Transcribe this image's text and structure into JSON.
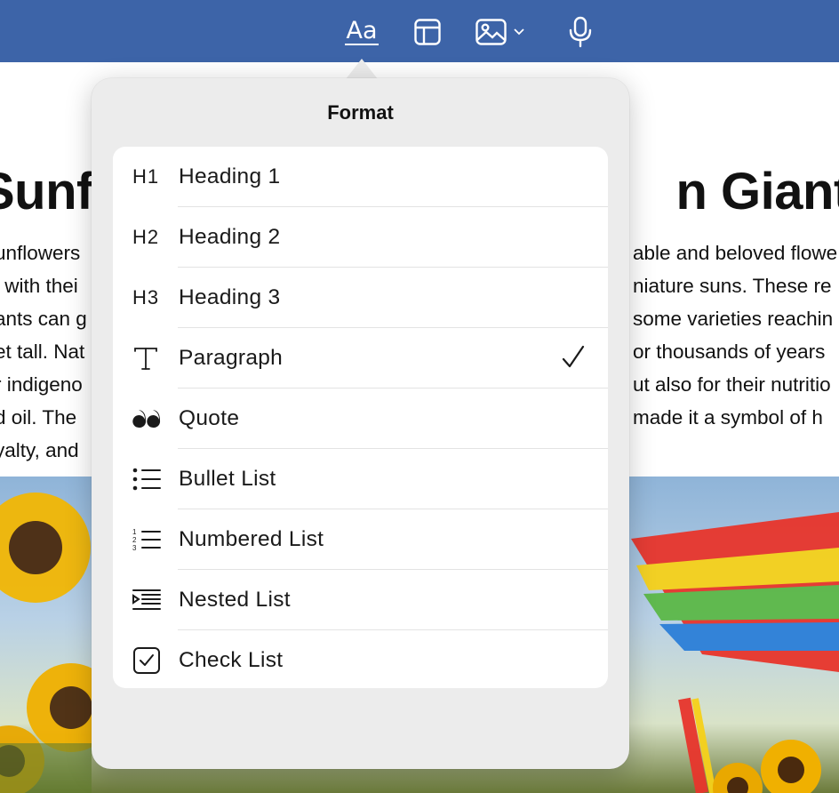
{
  "toolbar": {
    "icons": [
      {
        "name": "text-format-icon",
        "glyph": "Aa",
        "active": true
      },
      {
        "name": "table-icon"
      },
      {
        "name": "image-icon",
        "has_dropdown": true
      },
      {
        "name": "microphone-icon"
      }
    ],
    "background_color": "#3d64a8"
  },
  "document": {
    "title_left": "Sunfl",
    "title_right": "n Giants",
    "body_left": [
      "unflowers",
      "l with thei",
      "ants can g",
      "et tall. Nat",
      "r indigeno",
      "d oil. The",
      "yalty, and"
    ],
    "body_right": [
      "able and beloved flowe",
      "niature suns. These re",
      "some varieties reachin",
      "or thousands of years",
      "ut also for their nutritio",
      "made it a symbol of h",
      ""
    ]
  },
  "format_popover": {
    "title": "Format",
    "selected": "Paragraph",
    "items": [
      {
        "icon": "heading-1-icon",
        "icon_text": "H1",
        "label": "Heading 1"
      },
      {
        "icon": "heading-2-icon",
        "icon_text": "H2",
        "label": "Heading 2"
      },
      {
        "icon": "heading-3-icon",
        "icon_text": "H3",
        "label": "Heading 3"
      },
      {
        "icon": "paragraph-icon",
        "icon_text": "",
        "label": "Paragraph"
      },
      {
        "icon": "quote-icon",
        "icon_text": "",
        "label": "Quote"
      },
      {
        "icon": "bullet-list-icon",
        "icon_text": "",
        "label": "Bullet List"
      },
      {
        "icon": "numbered-list-icon",
        "icon_text": "",
        "label": "Numbered List"
      },
      {
        "icon": "nested-list-icon",
        "icon_text": "",
        "label": "Nested List"
      },
      {
        "icon": "check-list-icon",
        "icon_text": "",
        "label": "Check List"
      }
    ]
  }
}
